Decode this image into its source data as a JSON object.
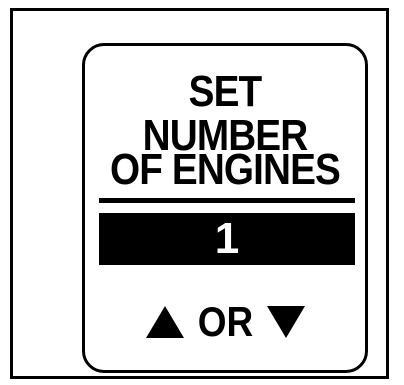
{
  "screen": {
    "title_line_1": "SET NUMBER",
    "title_line_2": "OF ENGINES",
    "value": "1",
    "nav_connector": "OR",
    "up_icon": "triangle-up-icon",
    "down_icon": "triangle-down-icon"
  },
  "colors": {
    "foreground": "#000000",
    "background": "#ffffff",
    "value_text": "#ffffff"
  }
}
